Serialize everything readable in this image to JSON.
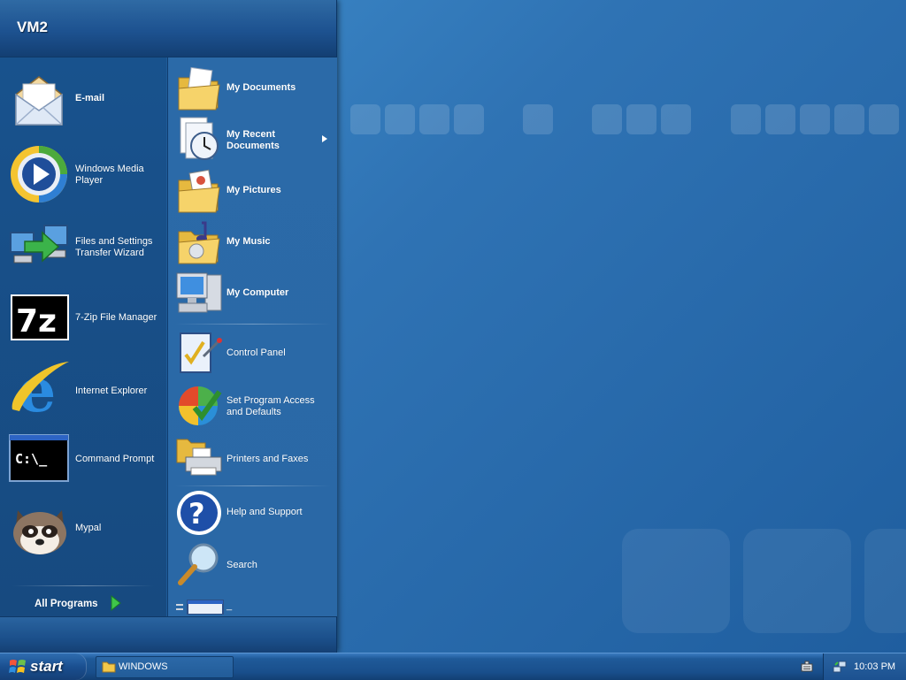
{
  "desktop": {
    "background_color": "#2f73b4"
  },
  "start_menu": {
    "user_name": "VM2",
    "pinned_items": [
      {
        "label": "E-mail",
        "icon": "email-icon"
      },
      {
        "label": "Windows Media Player",
        "icon": "media-player-icon"
      },
      {
        "label": "Files and Settings Transfer Wizard",
        "icon": "transfer-wizard-icon"
      },
      {
        "label": "7-Zip File Manager",
        "icon": "seven-zip-icon"
      },
      {
        "label": "Internet Explorer",
        "icon": "internet-explorer-icon"
      },
      {
        "label": "Command Prompt",
        "icon": "command-prompt-icon"
      },
      {
        "label": "Mypal",
        "icon": "mypal-raccoon-icon"
      }
    ],
    "all_programs_label": "All Programs",
    "places": [
      {
        "label": "My Documents",
        "icon": "folder-documents-icon"
      },
      {
        "label": "My Recent Documents",
        "icon": "recent-documents-icon"
      },
      {
        "label": "My Pictures",
        "icon": "folder-pictures-icon"
      },
      {
        "label": "My Music",
        "icon": "folder-music-icon"
      },
      {
        "label": "My Computer",
        "icon": "my-computer-icon"
      }
    ],
    "system": [
      {
        "label": "Control Panel",
        "icon": "control-panel-icon"
      },
      {
        "label": "Set Program Access and Defaults",
        "icon": "program-access-icon"
      },
      {
        "label": "Printers and Faxes",
        "icon": "printer-icon"
      }
    ],
    "help": [
      {
        "label": "Help and Support",
        "icon": "help-icon"
      },
      {
        "label": "Search",
        "icon": "search-icon"
      },
      {
        "label": "_",
        "icon": "run-icon"
      }
    ]
  },
  "taskbar": {
    "start_label": "start",
    "task_buttons": [
      {
        "label": "WINDOWS",
        "icon": "folder-icon"
      }
    ],
    "tray_icons": [
      "keyboard-icon",
      "network-icon"
    ],
    "clock": "10:03 PM"
  }
}
